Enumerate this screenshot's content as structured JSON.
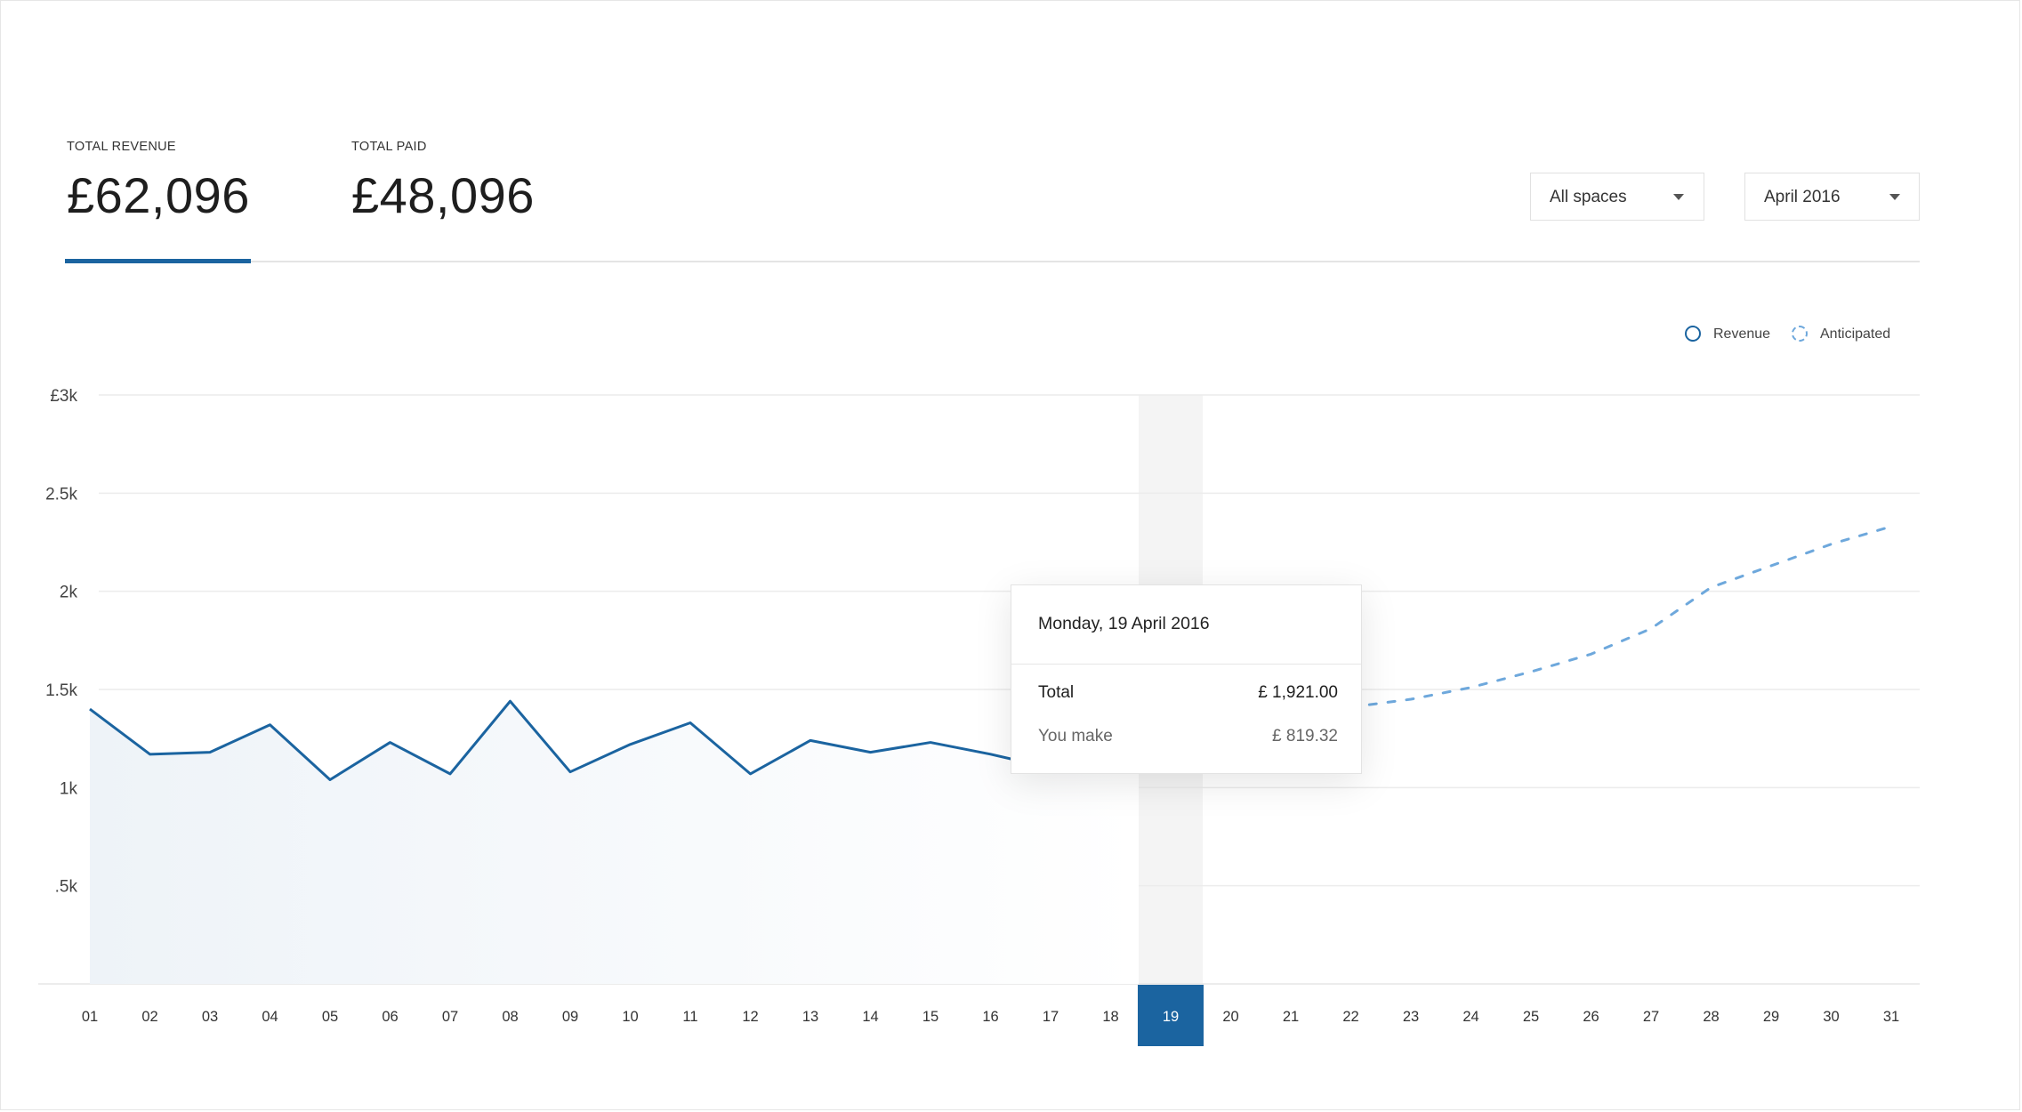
{
  "stats": {
    "revenue": {
      "label": "TOTAL REVENUE",
      "value": "£62,096"
    },
    "paid": {
      "label": "TOTAL PAID",
      "value": "£48,096"
    }
  },
  "filters": {
    "spaces": "All spaces",
    "month": "April 2016"
  },
  "legend": {
    "revenue": "Revenue",
    "anticipated": "Anticipated"
  },
  "tooltip": {
    "title": "Monday, 19 April 2016",
    "total_label": "Total",
    "total_value": "£ 1,921.00",
    "make_label": "You make",
    "make_value": "£ 819.32"
  },
  "colors": {
    "accent": "#1b64a0",
    "anticipated": "#6ea8dc",
    "highlight_band": "#f4f4f4"
  },
  "chart_data": {
    "type": "line",
    "title": "",
    "xlabel": "",
    "ylabel": "",
    "categories": [
      "01",
      "02",
      "03",
      "04",
      "05",
      "06",
      "07",
      "08",
      "09",
      "10",
      "11",
      "12",
      "13",
      "14",
      "15",
      "16",
      "17",
      "18",
      "19",
      "20",
      "21",
      "22",
      "23",
      "24",
      "25",
      "26",
      "27",
      "28",
      "29",
      "30",
      "31"
    ],
    "y_tick_labels": [
      ".5k",
      "1k",
      "1.5k",
      "2k",
      "2.5k",
      "£3k"
    ],
    "y_tick_values": [
      500,
      1000,
      1500,
      2000,
      2500,
      3000
    ],
    "ylim": [
      0,
      3000
    ],
    "highlighted_category": "19",
    "series": [
      {
        "name": "Revenue",
        "style": "solid-area",
        "points": [
          {
            "x": "01",
            "y": 1400
          },
          {
            "x": "02",
            "y": 1170
          },
          {
            "x": "03",
            "y": 1180
          },
          {
            "x": "04",
            "y": 1320
          },
          {
            "x": "05",
            "y": 1040
          },
          {
            "x": "06",
            "y": 1230
          },
          {
            "x": "07",
            "y": 1070
          },
          {
            "x": "08",
            "y": 1440
          },
          {
            "x": "09",
            "y": 1080
          },
          {
            "x": "10",
            "y": 1220
          },
          {
            "x": "11",
            "y": 1330
          },
          {
            "x": "12",
            "y": 1070
          },
          {
            "x": "13",
            "y": 1240
          },
          {
            "x": "14",
            "y": 1180
          },
          {
            "x": "15",
            "y": 1230
          },
          {
            "x": "16",
            "y": 1170
          },
          {
            "x": "17",
            "y": 1100
          }
        ]
      },
      {
        "name": "Anticipated",
        "style": "dashed",
        "points": [
          {
            "x": "22",
            "y": 1410
          },
          {
            "x": "23",
            "y": 1450
          },
          {
            "x": "24",
            "y": 1510
          },
          {
            "x": "25",
            "y": 1590
          },
          {
            "x": "26",
            "y": 1680
          },
          {
            "x": "27",
            "y": 1810
          },
          {
            "x": "28",
            "y": 2020
          },
          {
            "x": "29",
            "y": 2130
          },
          {
            "x": "30",
            "y": 2240
          },
          {
            "x": "31",
            "y": 2330
          }
        ]
      }
    ],
    "grid": true,
    "legend_position": "top-right"
  }
}
